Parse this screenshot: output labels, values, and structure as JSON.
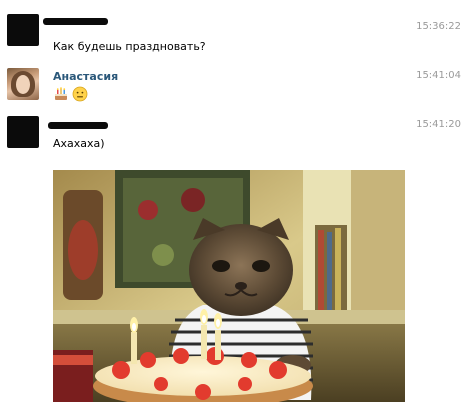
{
  "messages": [
    {
      "author": "",
      "author_redacted": true,
      "time": "15:36:22",
      "text": "Как будешь праздновать?"
    },
    {
      "author": "Анастасия",
      "author_redacted": false,
      "time": "15:41:04",
      "emojis": [
        "cake-icon",
        "neutral-face-icon"
      ]
    },
    {
      "author": "",
      "author_redacted": true,
      "time": "15:41:20",
      "text": "Ахахаха)",
      "attachment": "photo"
    }
  ],
  "colors": {
    "author_link": "#2b587a",
    "timestamp": "#9a9a9a",
    "text": "#000000"
  }
}
